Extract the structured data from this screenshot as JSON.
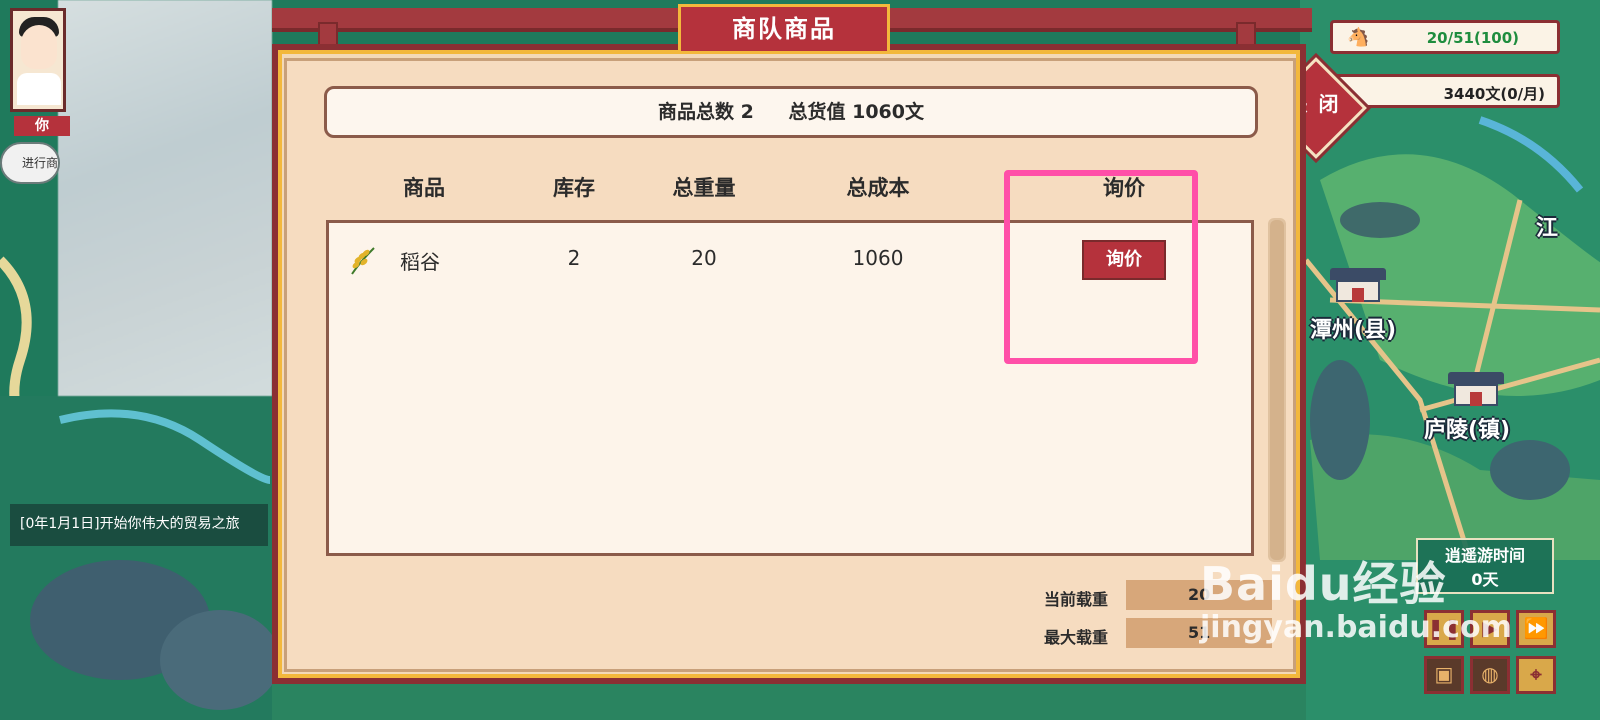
{
  "modal": {
    "title": "商队商品",
    "summary_count_label": "商品总数 2",
    "summary_value_label": "总货值 1060文",
    "columns": [
      "商品",
      "库存",
      "总重量",
      "总成本",
      "询价"
    ],
    "rows": [
      {
        "name": "稻谷",
        "stock": "2",
        "weight": "20",
        "cost": "1060",
        "action": "询价",
        "icon": "rice-grain-icon"
      }
    ],
    "current_load_label": "当前载重",
    "current_load_value": "20",
    "max_load_label": "最大载重",
    "max_load_value": "51"
  },
  "status": {
    "load": "20/51(100)",
    "money": "3440文(0/月)",
    "close_label": "关 闭"
  },
  "left": {
    "avatar_name": "你",
    "caravan_button": "进行商",
    "log": "[0年1月1日]开始你伟大的贸易之旅"
  },
  "map": {
    "labels": [
      "潭州(县)",
      "庐陵(镇)",
      "江"
    ],
    "time_title": "逍遥游时间",
    "time_value": "0天"
  },
  "watermark": {
    "brand": "Baidu经验",
    "url": "jingyan.baidu.com"
  },
  "colors": {
    "primary_red": "#b5323c",
    "highlight_pink": "#ff4fa8",
    "load_green": "#1f8d3e"
  }
}
